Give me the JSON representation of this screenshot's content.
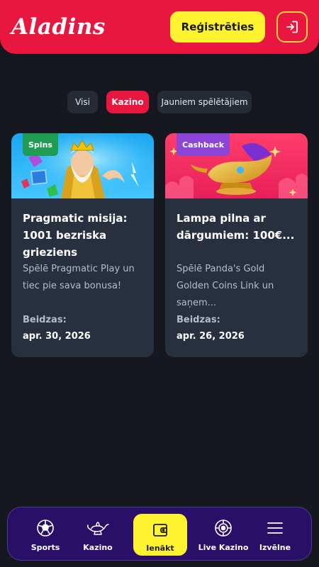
{
  "header": {
    "logo_text": "Aladins",
    "register_label": "Reģistrēties",
    "brand_color": "#e9163f",
    "cta_color": "#fff22f"
  },
  "filters": [
    {
      "label": "Visi",
      "active": false
    },
    {
      "label": "Kazino",
      "active": true
    },
    {
      "label": "Jauniem spēlētājiem",
      "active": false
    }
  ],
  "promotions": [
    {
      "badge": "Spins",
      "badge_color": "#1f9b54",
      "title": "Pragmatic misija: 1001 bezriska grieziens",
      "description": "Spēlē Pragmatic Play un tiec pie sava bonusa!",
      "deadline_label": "Beidzas:",
      "deadline": "apr. 30, 2026"
    },
    {
      "badge": "Cashback",
      "badge_color": "#8c45d6",
      "title": "Lampa pilna ar dārgumiem: 100€...",
      "description": "Spēlē Panda's Gold Golden Coins Link un saņem...",
      "deadline_label": "Beidzas:",
      "deadline": "apr. 26, 2026"
    }
  ],
  "bottom_nav": [
    {
      "label": "Sports",
      "icon": "soccer-ball-icon"
    },
    {
      "label": "Kazino",
      "icon": "magic-lamp-icon"
    },
    {
      "label": "Ienākt",
      "icon": "wallet-icon"
    },
    {
      "label": "Live Kazino",
      "icon": "casino-chip-icon"
    },
    {
      "label": "Izvēlne",
      "icon": "hamburger-menu-icon"
    }
  ]
}
